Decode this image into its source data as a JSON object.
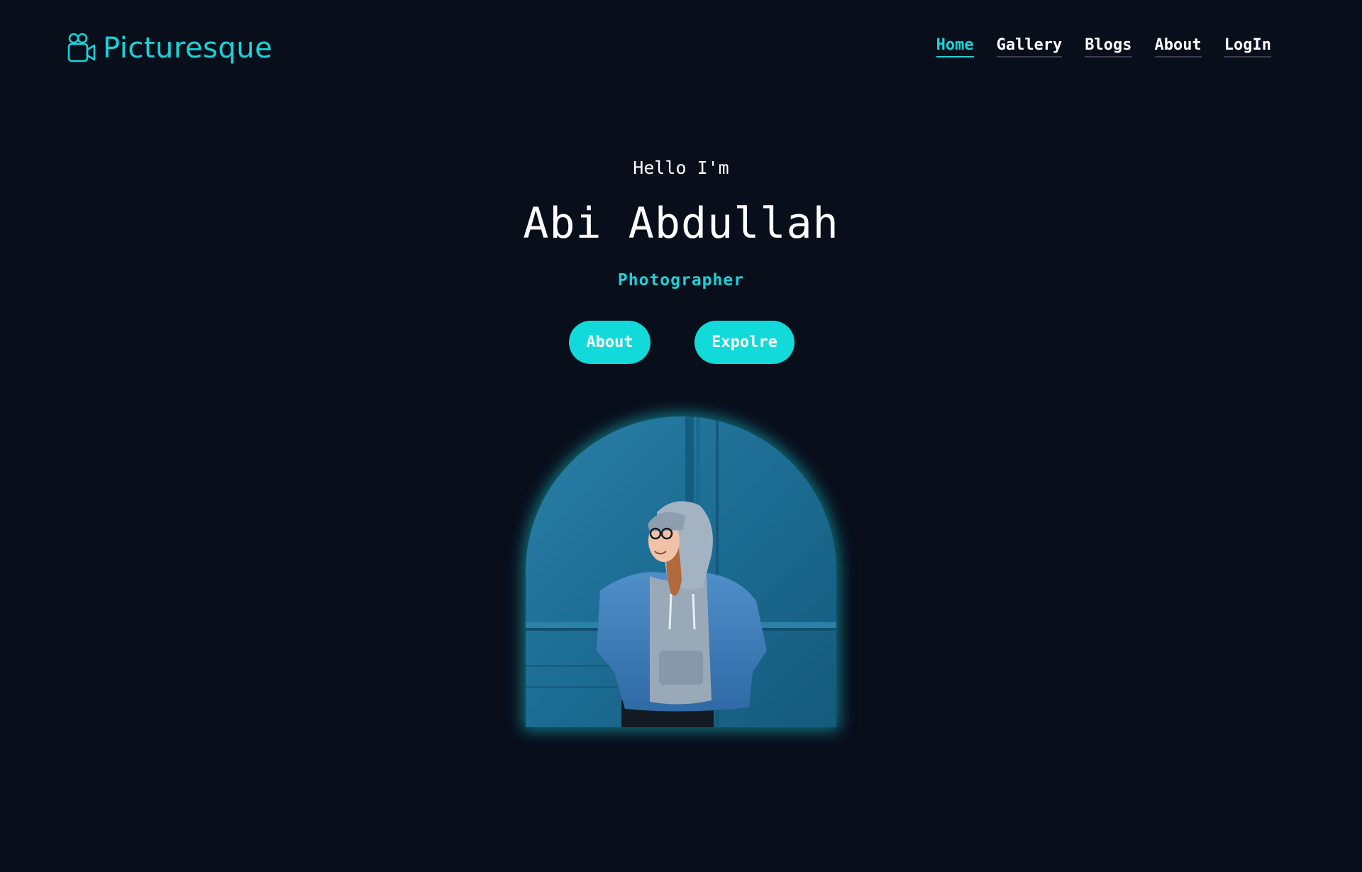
{
  "brand": {
    "name": "Picturesque",
    "icon": "video-camera-icon",
    "color": "#18d3d9"
  },
  "nav": {
    "items": [
      {
        "label": "Home",
        "active": true
      },
      {
        "label": "Gallery",
        "active": false
      },
      {
        "label": "Blogs",
        "active": false
      },
      {
        "label": "About",
        "active": false
      },
      {
        "label": "LogIn",
        "active": false
      }
    ]
  },
  "hero": {
    "greeting": "Hello I'm",
    "name": "Abi Abdullah",
    "role": "Photographer",
    "buttons": {
      "about": "About",
      "explore": "Expolre"
    }
  },
  "theme": {
    "background": "#090e1b",
    "accent": "#18d3d9",
    "button_bg": "#12dada",
    "text": "#ffffff"
  }
}
